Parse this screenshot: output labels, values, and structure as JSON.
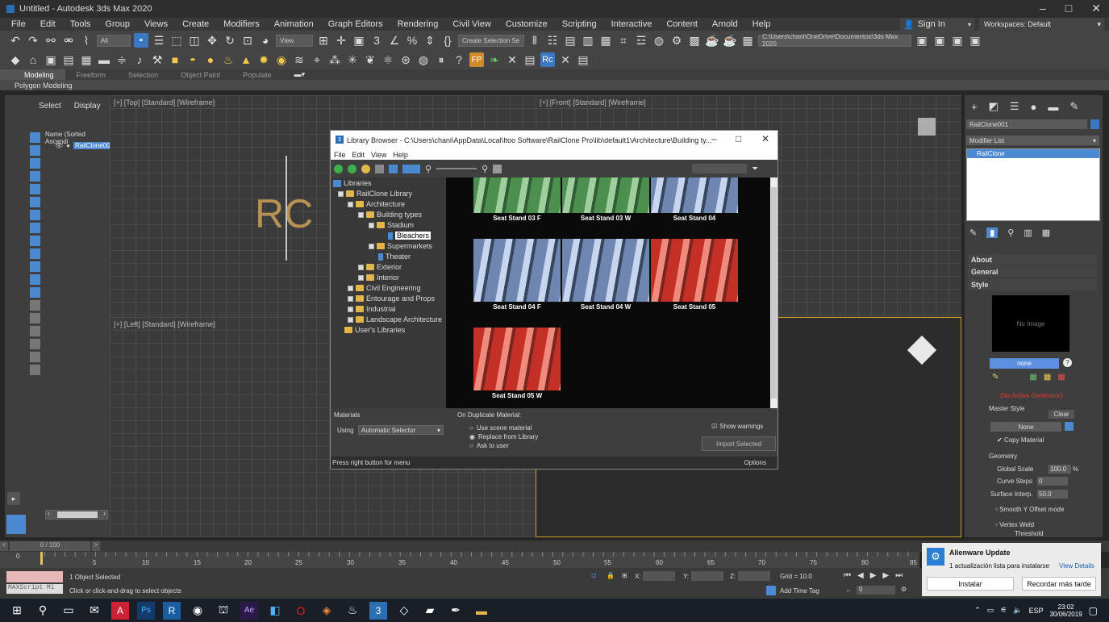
{
  "window": {
    "title": "Untitled - Autodesk 3ds Max 2020"
  },
  "menu": [
    "File",
    "Edit",
    "Tools",
    "Group",
    "Views",
    "Create",
    "Modifiers",
    "Animation",
    "Graph Editors",
    "Rendering",
    "Civil View",
    "Customize",
    "Scripting",
    "Interactive",
    "Content",
    "Arnold",
    "Help"
  ],
  "signin": "Sign In",
  "workspaces": {
    "label": "Workspaces:",
    "value": "Default"
  },
  "toolbar": {
    "filter_all": "All",
    "view_dropdown": "View",
    "selection_set": "Create Selection Se",
    "project_path": "C:\\Users\\chani\\OneDrive\\Documentos\\3ds Max 2020"
  },
  "ribbon": {
    "tabs": [
      "Modeling",
      "Freeform",
      "Selection",
      "Object Paint",
      "Populate"
    ],
    "sub": "Polygon Modeling"
  },
  "scene_explorer": {
    "tabs": [
      "Select",
      "Display"
    ],
    "column": "Name (Sorted Ascendi",
    "item": "RailClone00"
  },
  "viewports": {
    "top": "[+] [Top] [Standard] [Wireframe]",
    "front": "[+] [Front] [Standard] [Wireframe]",
    "left": "[+] [Left] [Standard] [Wireframe]"
  },
  "dialog": {
    "title": "Library Browser - C:\\Users\\chani\\AppData\\Local\\Itoo Software\\RailClone Pro\\lib\\default1\\Architecture\\Building ty...",
    "menu": [
      "File",
      "Edit",
      "View",
      "Help"
    ],
    "tree": [
      {
        "label": "Libraries"
      },
      {
        "label": "RailClone Library"
      },
      {
        "label": "Architecture"
      },
      {
        "label": "Building types"
      },
      {
        "label": "Stadium"
      },
      {
        "label": "Bleachers"
      },
      {
        "label": "Supermarkets"
      },
      {
        "label": "Theater"
      },
      {
        "label": "Exterior"
      },
      {
        "label": "Interior"
      },
      {
        "label": "Civil Engineering"
      },
      {
        "label": "Entourage and Props"
      },
      {
        "label": "Industrial"
      },
      {
        "label": "Landscape Architecture"
      },
      {
        "label": "User's Libraries"
      }
    ],
    "items": [
      {
        "caption": "Seat Stand 03 F"
      },
      {
        "caption": "Seat Stand 03 W"
      },
      {
        "caption": "Seat Stand 04"
      },
      {
        "caption": "Seat Stand 04 F"
      },
      {
        "caption": "Seat Stand 04 W"
      },
      {
        "caption": "Seat Stand 05"
      },
      {
        "caption": "Seat Stand 05 W"
      }
    ],
    "materials_label": "Materials",
    "using_label": "Using",
    "using_value": "Automatic Selector",
    "duplicate_label": "On Duplicate Material:",
    "dup_options": [
      "Use scene material",
      "Replace from Library",
      "Ask to user"
    ],
    "show_warnings": "Show warnings",
    "import_button": "Import Selected",
    "status": "Press right button for menu",
    "options": "Options"
  },
  "command_panel": {
    "object_name": "RailClone001",
    "modifier_list": "Modifier List",
    "stack_item": "RailClone",
    "rollouts": [
      "About",
      "General",
      "Style"
    ],
    "no_image": "No Image",
    "none_button": "none",
    "no_active": "(No Active Generator)",
    "master_style": "Master Style",
    "clear": "Clear",
    "none2": "None",
    "copy_material": "Copy Material",
    "geometry": "Geometry",
    "global_scale_label": "Global Scale",
    "global_scale": "100.0",
    "curve_steps_label": "Curve Steps",
    "curve_steps": "0",
    "surface_interp_label": "Surface Interp.",
    "surface_interp": "50.0",
    "smooth_y": "Smooth Y Offset mode",
    "vertex_weld": "Vertex Weld",
    "threshold": "Threshold"
  },
  "timeline": {
    "frame": "0 / 100",
    "ticks": [
      "0",
      "5",
      "10",
      "15",
      "20",
      "25",
      "30",
      "35",
      "40",
      "45",
      "50",
      "55",
      "60",
      "65",
      "70",
      "75",
      "80",
      "85"
    ]
  },
  "status": {
    "maxscript": "MAXScript Mi",
    "selected": "1 Object Selected",
    "prompt": "Click or click-and-drag to select objects",
    "x_label": "X:",
    "y_label": "Y:",
    "z_label": "Z:",
    "grid": "Grid = 10.0",
    "add_time_tag": "Add Time Tag",
    "frame_field": "0"
  },
  "toast": {
    "title": "Alienware Update",
    "body": "1 actualización lista para instalarse",
    "link": "View Details",
    "install": "Instalar",
    "remind": "Recordar más tarde"
  },
  "tray": {
    "lang": "ESP",
    "time": "23:02",
    "date": "30/06/2019"
  }
}
